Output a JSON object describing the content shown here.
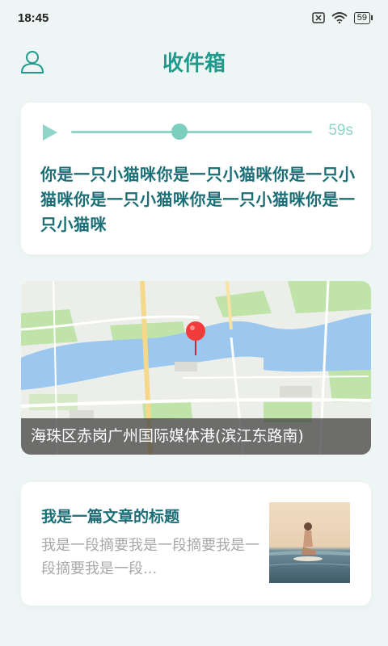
{
  "status_bar": {
    "time": "18:45",
    "battery": "59",
    "icons": [
      "sim-off-icon",
      "wifi-icon",
      "battery-icon"
    ]
  },
  "header": {
    "title": "收件箱",
    "profile_icon": "user-icon"
  },
  "voice_message": {
    "duration": "59s",
    "progress": 0.45,
    "text": "你是一只小猫咪你是一只小猫咪你是一只小猫咪你是一只小猫咪你是一只小猫咪你是一只小猫咪"
  },
  "location": {
    "address": "海珠区赤岗广州国际媒体港(滨江东路南)"
  },
  "article": {
    "title": "我是一篇文章的标题",
    "summary": "我是一段摘要我是一段摘要我是一段摘要我是一段..."
  },
  "colors": {
    "accent": "#1f9a8c",
    "text_dark_teal": "#1a6e76",
    "track": "#8fd5c8",
    "background": "#eef6f5"
  }
}
